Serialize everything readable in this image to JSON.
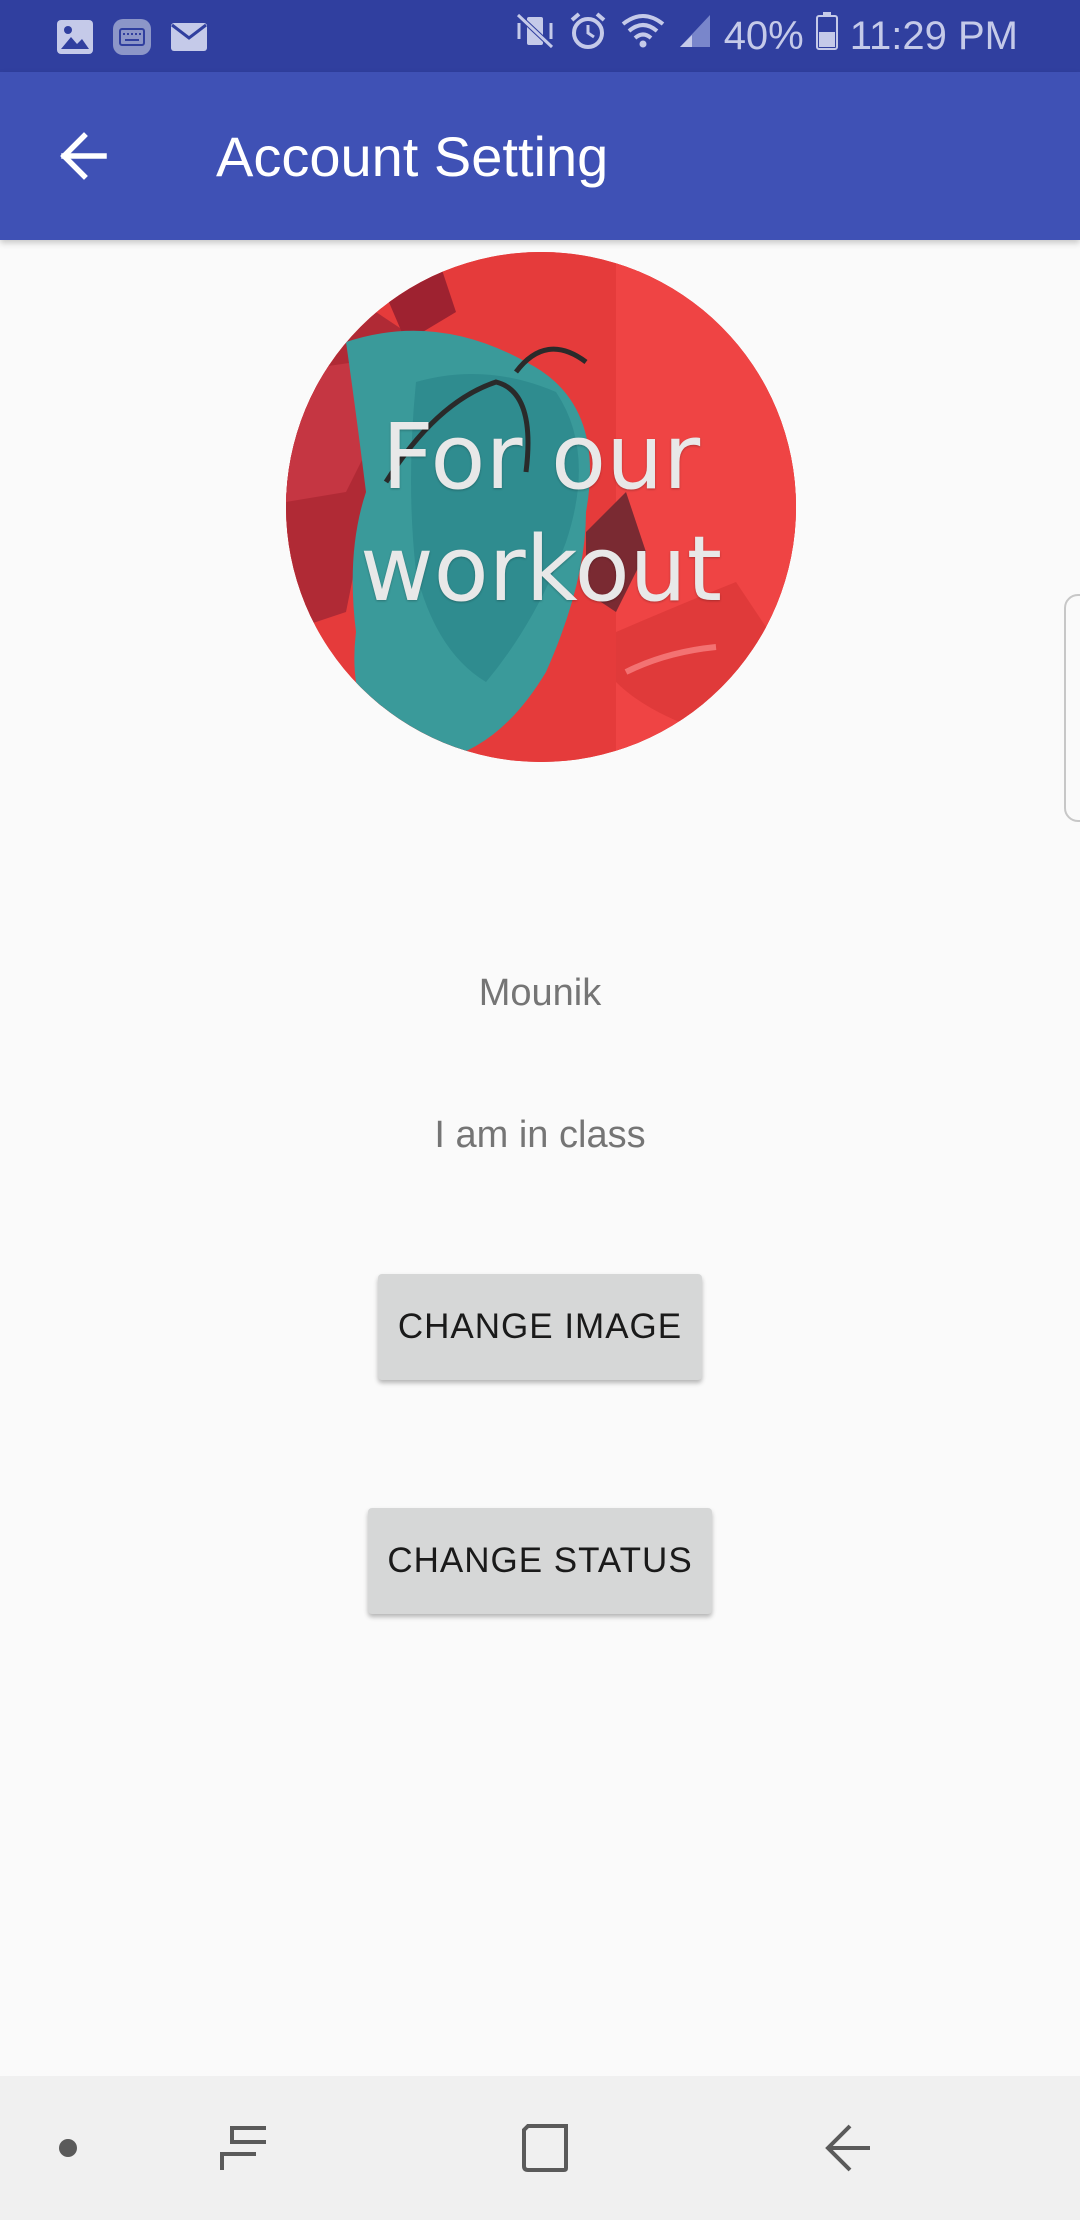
{
  "status_bar": {
    "battery": "40%",
    "time": "11:29 PM",
    "left_icons": [
      "image-icon",
      "keyboard-icon",
      "mail-icon"
    ],
    "right_icons": [
      "vibrate-icon",
      "alarm-icon",
      "wifi-icon",
      "signal-icon",
      "battery-icon"
    ]
  },
  "app_bar": {
    "title": "Account Setting",
    "back_icon": "arrow-back-icon"
  },
  "profile": {
    "image_caption_line1": "For our",
    "image_caption_line2": "workout",
    "name": "Mounik",
    "status": "I am in class"
  },
  "buttons": {
    "change_image": "CHANGE IMAGE",
    "change_status": "CHANGE STATUS"
  },
  "nav_bar": {
    "items": [
      "dot-icon",
      "recents-icon",
      "home-icon",
      "back-icon"
    ]
  },
  "colors": {
    "status_bar": "#303f9f",
    "app_bar": "#3f51b5",
    "background": "#fafafa",
    "button": "#d6d7d7"
  }
}
